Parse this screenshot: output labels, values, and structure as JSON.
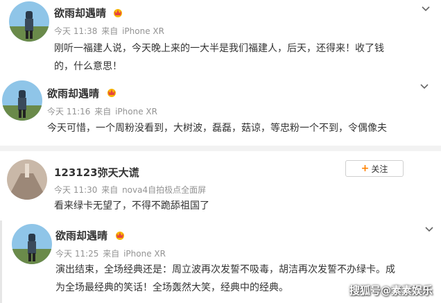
{
  "posts": [
    {
      "name": "欲雨却遇晴",
      "time": "今天 11:38",
      "source_prefix": "来自",
      "source": "iPhone XR",
      "text_line1": "刚听一福建人说，今天晚上来的一大半是我们福建人，后天，还得来！收了钱",
      "text_line2": "的，什么意思！"
    },
    {
      "name": "欲雨却遇晴",
      "time": "今天 11:16",
      "source_prefix": "来自",
      "source": "iPhone XR",
      "text_line1": "今天可惜，一个周粉没看到，大树波，磊磊，菇谅，等忠粉一个不到，令偶像夫"
    },
    {
      "name": "123123弥天大谎",
      "time": "今天 11:30",
      "source_prefix": "来自",
      "source": "nova4自拍极点全面屏",
      "follow_label": "关注",
      "text_line1": "看来绿卡无望了，不得不跪舔祖国了"
    },
    {
      "name": "欲雨却遇晴",
      "time": "今天 11:25",
      "source_prefix": "来自",
      "source": "iPhone XR",
      "text_line1": "演出结束，全场经典还是：周立波再次发誓不吸毒，胡洁再次发誓不办绿卡。成",
      "text_line2": "为全场最经典的笑话！全场轰然大笑，经典中的经典。"
    }
  ],
  "watermark": "搜狐号@素素娱乐",
  "colors": {
    "meta": "#939393",
    "accent": "#ff8200",
    "divider": "#f2f2f2"
  },
  "icons": [
    "vip-crown-icon",
    "chevron-down-icon",
    "plus-icon"
  ]
}
